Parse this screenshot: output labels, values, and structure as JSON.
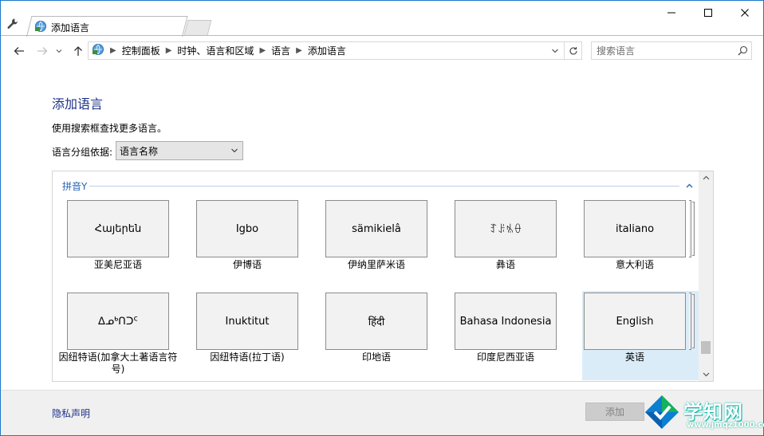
{
  "window": {
    "tab_title": "添加语言",
    "controls": {
      "minimize": "—",
      "maximize": "☐",
      "close": "✕"
    }
  },
  "nav": {
    "breadcrumbs": [
      "控制面板",
      "时钟、语言和区域",
      "语言",
      "添加语言"
    ],
    "search_placeholder": "搜索语言"
  },
  "main": {
    "heading": "添加语言",
    "hint": "使用搜索框查找更多语言。",
    "group_by_label": "语言分组依据:",
    "group_by_value": "语言名称",
    "group_header": "拼音Y",
    "tiles": [
      {
        "native": "Հայերեն",
        "name": "亚美尼亚语",
        "selected": false,
        "stacked": false
      },
      {
        "native": "Igbo",
        "name": "伊博语",
        "selected": false,
        "stacked": false
      },
      {
        "native": "sämikielâ",
        "name": "伊纳里萨米语",
        "selected": false,
        "stacked": false
      },
      {
        "native": "ꆈꌠꁱꂷ",
        "name": "彝语",
        "selected": false,
        "stacked": false
      },
      {
        "native": "italiano",
        "name": "意大利语",
        "selected": false,
        "stacked": true
      },
      {
        "native": "ᐃᓄᒃᑎᑐᑦ",
        "name": "因纽特语(加拿大土著语言符号)",
        "selected": false,
        "stacked": false
      },
      {
        "native": "Inuktitut",
        "name": "因纽特语(拉丁语)",
        "selected": false,
        "stacked": false
      },
      {
        "native": "हिंदी",
        "name": "印地语",
        "selected": false,
        "stacked": false
      },
      {
        "native": "Bahasa Indonesia",
        "name": "印度尼西亚语",
        "selected": false,
        "stacked": false
      },
      {
        "native": "English",
        "name": "英语",
        "selected": true,
        "stacked": true
      }
    ]
  },
  "footer": {
    "privacy_link": "隐私声明",
    "add_button": "添加"
  },
  "watermark": {
    "text": "学知网",
    "url": "www.jmqz1000.com"
  },
  "colors": {
    "heading": "#1e3287",
    "group_header": "#2a66b8",
    "selected_tile": "#dbecf9",
    "window_border": "#1979ca"
  },
  "icons": [
    "wrench-icon",
    "control-panel-icon",
    "back-arrow-icon",
    "forward-arrow-icon",
    "chevron-down-icon",
    "up-arrow-icon",
    "refresh-icon",
    "search-icon",
    "chevron-up-icon"
  ]
}
